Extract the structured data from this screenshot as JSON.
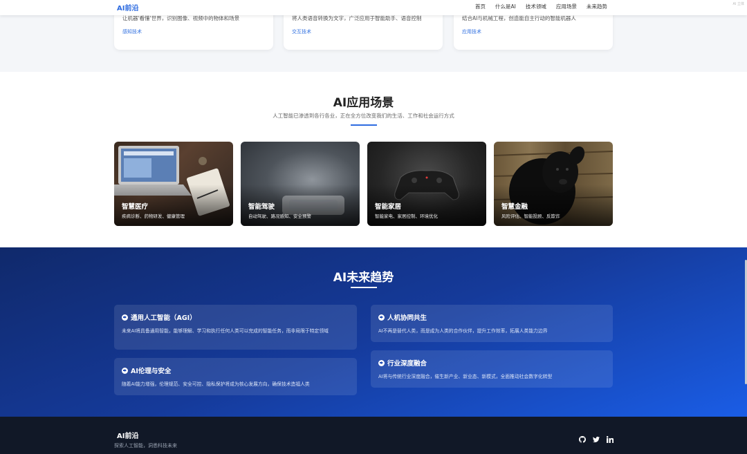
{
  "nav": {
    "logo": "AI前沿",
    "links": [
      "首页",
      "什么是AI",
      "技术领域",
      "应用场景",
      "未来趋势"
    ],
    "faint": "AI 立体"
  },
  "tech_cards": [
    {
      "desc": "让机器'看懂'世界，识别图像、视频中的物体和场景",
      "tag": "感知技术"
    },
    {
      "desc": "将人类语音转换为文字，广泛应用于智能助手、语音控制",
      "tag": "交互技术"
    },
    {
      "desc": "结合AI与机械工程，创造能自主行动的智能机器人",
      "tag": "应用技术"
    }
  ],
  "scenarios": {
    "title": "AI应用场景",
    "subtitle": "人工智能已渗透到各行各业，正在全方位改变我们的生活、工作和社会运行方式",
    "cards": [
      {
        "title": "智慧医疗",
        "subtitle": "疾病诊断、药物研发、健康管理"
      },
      {
        "title": "智能驾驶",
        "subtitle": "自动驾驶、路况感知、安全预警"
      },
      {
        "title": "智能家居",
        "subtitle": "智能家电、家居控制、环境优化"
      },
      {
        "title": "智慧金融",
        "subtitle": "风险评估、智能投顾、反欺诈"
      }
    ]
  },
  "trends": {
    "title": "AI未来趋势",
    "items": [
      {
        "title": "通用人工智能（AGI）",
        "text": "未来AI将具备通用智能，能够理解、学习和执行任何人类可以完成的智能任务，而非局限于特定领域"
      },
      {
        "title": "人机协同共生",
        "text": "AI不再是替代人类，而是成为人类的合作伙伴，提升工作效率，拓展人类能力边界"
      },
      {
        "title": "AI伦理与安全",
        "text": "随着AI能力增强，伦理规范、安全可控、隐私保护将成为核心发展方向，确保技术造福人类"
      },
      {
        "title": "行业深度融合",
        "text": "AI将与传统行业深度融合，催生新产业、新业态、新模式，全面推动社会数字化转型"
      }
    ]
  },
  "footer": {
    "logo": "AI前沿",
    "slogan": "探索人工智能，洞悉科技未来",
    "social_icons": [
      "github-icon",
      "twitter-icon",
      "linkedin-icon"
    ]
  },
  "colors": {
    "brand": "#2d6be0",
    "footer_bg": "#111827",
    "trend_bg_start": "#10296b",
    "trend_bg_end": "#1a5de6"
  }
}
